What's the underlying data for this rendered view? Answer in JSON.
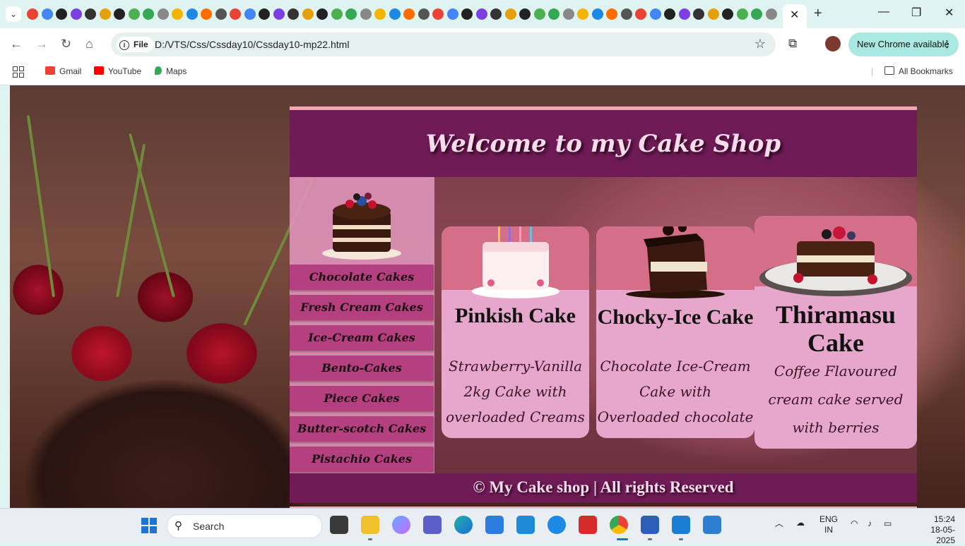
{
  "browser": {
    "active_tab_close": "✕",
    "new_tab": "+",
    "window_controls": {
      "minimize": "—",
      "maximize": "❐",
      "close": "✕"
    },
    "address": {
      "scheme_label": "File",
      "url": "D:/VTS/Css/Cssday10/Cssday10-mp22.html"
    },
    "update_button": "New Chrome available",
    "bookmarks": [
      {
        "label": "Gmail",
        "icon": "gmail-icon",
        "color": "#ea4335"
      },
      {
        "label": "YouTube",
        "icon": "youtube-icon",
        "color": "#ff0000"
      },
      {
        "label": "Maps",
        "icon": "maps-icon",
        "color": "#34a853"
      }
    ],
    "all_bookmarks": "All Bookmarks"
  },
  "site": {
    "title": "Welcome to my Cake Shop",
    "menu": [
      "Chocolate Cakes",
      "Fresh Cream Cakes",
      "Ice-Cream Cakes",
      "Bento-Cakes",
      "Piece Cakes",
      "Butter-scotch Cakes",
      "Pistachio Cakes"
    ],
    "products": [
      {
        "name": "Pinkish Cake",
        "description": "Strawberry-Vanilla 2kg Cake with overloaded Creams"
      },
      {
        "name": "Chocky-Ice Cake",
        "description": "Chocolate Ice-Cream Cake with Overloaded chocolate"
      },
      {
        "name": "Thiramasu Cake",
        "description": "Coffee Flavoured cream cake served with berries"
      }
    ],
    "footer": "© My Cake shop | All rights Reserved",
    "colors": {
      "header": "#6f1b55",
      "menu": "#b5407f",
      "card": "#e7a6cc",
      "accent": "#f2a7b4"
    }
  },
  "taskbar": {
    "search_placeholder": "Search",
    "language": "ENG",
    "region": "IN",
    "time": "15:24",
    "date": "18-05-2025"
  }
}
